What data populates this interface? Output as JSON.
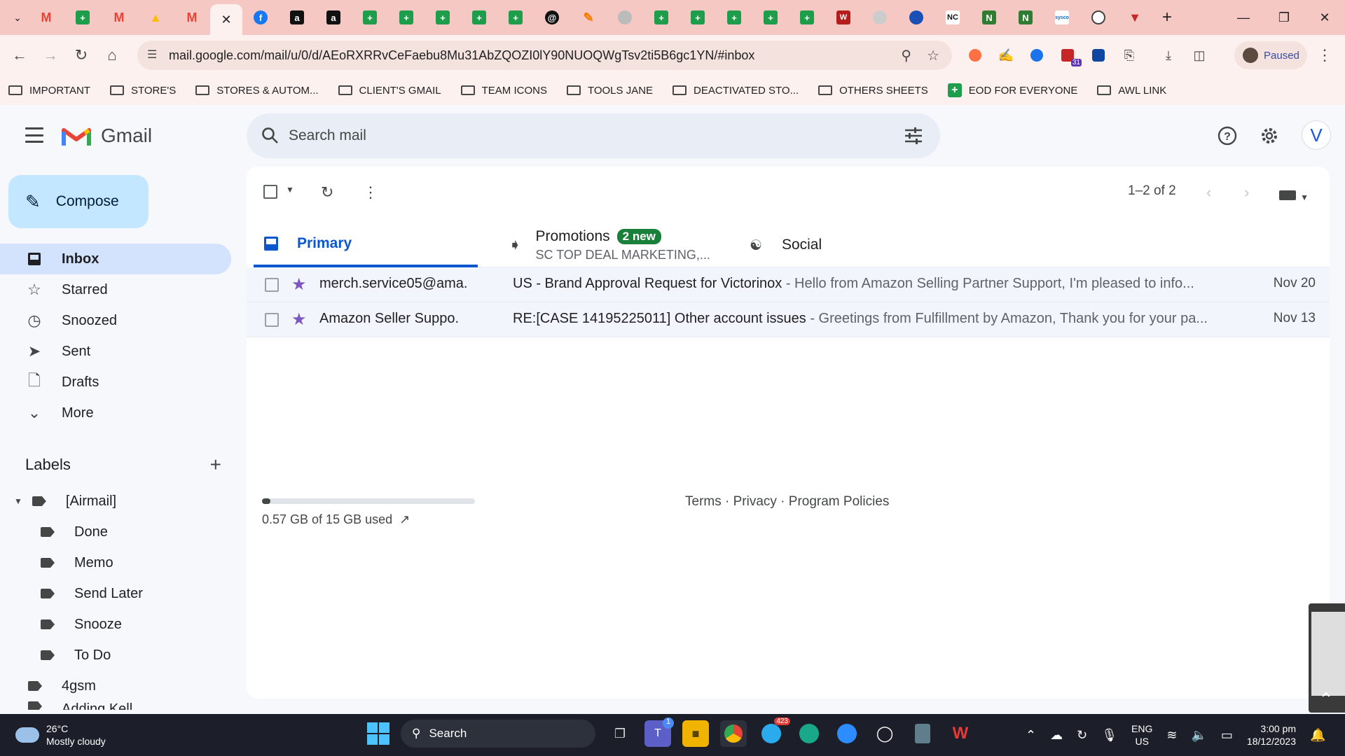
{
  "browser": {
    "url": "mail.google.com/mail/u/0/d/AEoRXRRvCeFaebu8Mu31AbZQOZI0lY90NUOQWgTsv2ti5B6gc1YN/#inbox",
    "profile_status": "Paused",
    "bookmarks": [
      "IMPORTANT",
      "STORE'S",
      "STORES & AUTOM...",
      "CLIENT'S GMAIL",
      "TEAM ICONS",
      "TOOLS JANE",
      "DEACTIVATED STO...",
      "OTHERS SHEETS",
      "EOD FOR EVERYONE",
      "AWL LINK"
    ],
    "calendar_ext_badge": "31"
  },
  "gmail": {
    "logo_text": "Gmail",
    "search_placeholder": "Search mail",
    "account_initial": "V",
    "compose_label": "Compose",
    "nav": [
      "Inbox",
      "Starred",
      "Snoozed",
      "Sent",
      "Drafts",
      "More"
    ],
    "labels_title": "Labels",
    "labels": [
      "[Airmail]",
      "Done",
      "Memo",
      "Send Later",
      "Snooze",
      "To Do",
      "4gsm",
      "Adding Kell..."
    ],
    "pager": "1–2 of 2",
    "tabs": {
      "primary": "Primary",
      "promotions": "Promotions",
      "promotions_badge": "2 new",
      "promotions_sub": "SC TOP DEAL MARKETING,...",
      "social": "Social"
    },
    "emails": [
      {
        "sender": "merch.service05@ama.",
        "subject": "US - Brand Approval Request for Victorinox",
        "snippet": " - Hello from Amazon Selling Partner Support, I'm pleased to info...",
        "date": "Nov 20"
      },
      {
        "sender": "Amazon Seller Suppo.",
        "subject": "RE:[CASE 14195225011] Other account issues",
        "snippet": " - Greetings from Fulfillment by Amazon, Thank you for your pa...",
        "date": "Nov 13"
      }
    ],
    "storage_text": "0.57 GB of 15 GB used",
    "storage_fraction": 0.038,
    "footer": "Terms · Privacy · Program Policies"
  },
  "taskbar": {
    "temp": "26°C",
    "weather": "Mostly cloudy",
    "search": "Search",
    "teams_badge": "1",
    "telegram_badge": "423",
    "lang": "ENG",
    "region": "US",
    "time": "3:00 pm",
    "date": "18/12/2023"
  },
  "colors": {
    "tabstrip": "#f6c8c3",
    "gmail_red": "#ea4335",
    "primary_blue": "#0b57d0",
    "badge_green": "#188038",
    "star_purple": "#7e57c2"
  }
}
